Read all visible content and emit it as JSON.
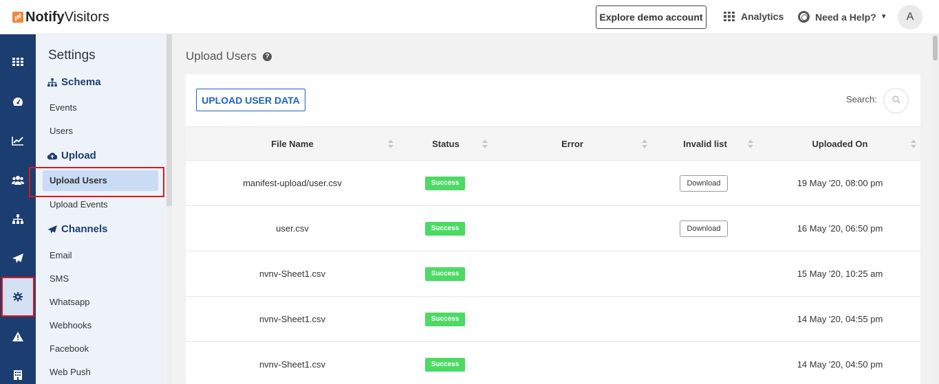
{
  "header": {
    "logo_bold": "Notify",
    "logo_regular": "Visitors",
    "demo_label": "Explore demo account",
    "analytics_label": "Analytics",
    "help_label": "Need a Help?",
    "avatar_initial": "A"
  },
  "leftnav": {
    "items": [
      {
        "icon": "grid-icon"
      },
      {
        "icon": "dashboard-gauge-icon"
      },
      {
        "icon": "line-chart-icon"
      },
      {
        "icon": "users-icon"
      },
      {
        "icon": "sitemap-icon"
      },
      {
        "icon": "paper-plane-icon"
      },
      {
        "icon": "gear-icon",
        "active": true
      },
      {
        "icon": "warning-icon"
      },
      {
        "icon": "building-icon"
      }
    ]
  },
  "sidebar": {
    "title": "Settings",
    "schema": {
      "label": "Schema",
      "items": [
        "Events",
        "Users"
      ]
    },
    "upload": {
      "label": "Upload",
      "items": [
        "Upload Users",
        "Upload Events"
      ],
      "active": "Upload Users"
    },
    "channels": {
      "label": "Channels",
      "items": [
        "Email",
        "SMS",
        "Whatsapp",
        "Webhooks",
        "Facebook",
        "Web Push"
      ]
    }
  },
  "main": {
    "title": "Upload Users",
    "upload_button": "UPLOAD USER DATA",
    "search_label": "Search:",
    "columns": [
      "File Name",
      "Status",
      "Error",
      "Invalid list",
      "Uploaded On"
    ],
    "rows": [
      {
        "file": "manifest-upload/user.csv",
        "status": "Success",
        "error": "",
        "invalid": "Download",
        "uploaded": "19 May '20, 08:00 pm"
      },
      {
        "file": "user.csv",
        "status": "Success",
        "error": "",
        "invalid": "Download",
        "uploaded": "16 May '20, 06:50 pm"
      },
      {
        "file": "nvnv-Sheet1.csv",
        "status": "Success",
        "error": "",
        "invalid": "",
        "uploaded": "15 May '20, 10:25 am"
      },
      {
        "file": "nvnv-Sheet1.csv",
        "status": "Success",
        "error": "",
        "invalid": "",
        "uploaded": "14 May '20, 04:55 pm"
      },
      {
        "file": "nvnv-Sheet1.csv",
        "status": "Success",
        "error": "",
        "invalid": "",
        "uploaded": "14 May '20, 04:50 pm"
      }
    ]
  },
  "colors": {
    "nav_bg": "#1c3d70",
    "accent_blue": "#1c63b8",
    "success_green": "#4cd964",
    "highlight_red": "#e0151d"
  }
}
